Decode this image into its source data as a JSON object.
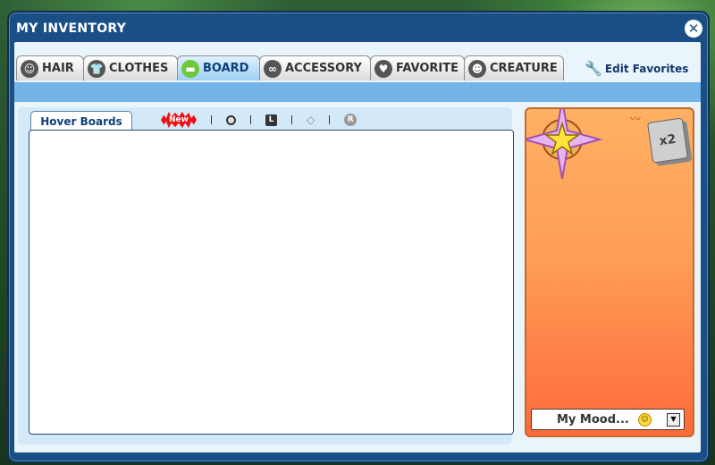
{
  "window": {
    "title": "MY INVENTORY",
    "close_glyph": "✕"
  },
  "tabs": [
    {
      "label": "HAIR",
      "icon": "hair-icon",
      "glyph": "☺",
      "active": false
    },
    {
      "label": "CLOTHES",
      "icon": "shirt-icon",
      "glyph": "👕",
      "active": false
    },
    {
      "label": "BOARD",
      "icon": "board-icon",
      "glyph": "▬",
      "active": true
    },
    {
      "label": "ACCESSORY",
      "icon": "goggles-icon",
      "glyph": "∞",
      "active": false
    },
    {
      "label": "FAVORITE",
      "icon": "heart-icon",
      "glyph": "♥",
      "active": false
    },
    {
      "label": "CREATURE",
      "icon": "creature-icon",
      "glyph": "☻",
      "active": false
    }
  ],
  "edit_favorites": {
    "label": "Edit Favorites",
    "icon": "wrench-icon"
  },
  "subtab": {
    "label": "Hover Boards"
  },
  "filters": {
    "new_label": "New",
    "ring_icon": "ring-icon",
    "l_label": "L",
    "gem_icon": "diamond-icon",
    "r_label": "R"
  },
  "profile": {
    "badge_icon": "star-badge-icon",
    "multiplier": "x2",
    "mood_label": "My Mood...",
    "mood_icon": "smiley-icon"
  },
  "colors": {
    "window_border": "#1a4f86",
    "active_tab": "#9fd0f3",
    "profile_gradient_top": "#ffb062",
    "profile_gradient_bottom": "#ff6a3a"
  }
}
